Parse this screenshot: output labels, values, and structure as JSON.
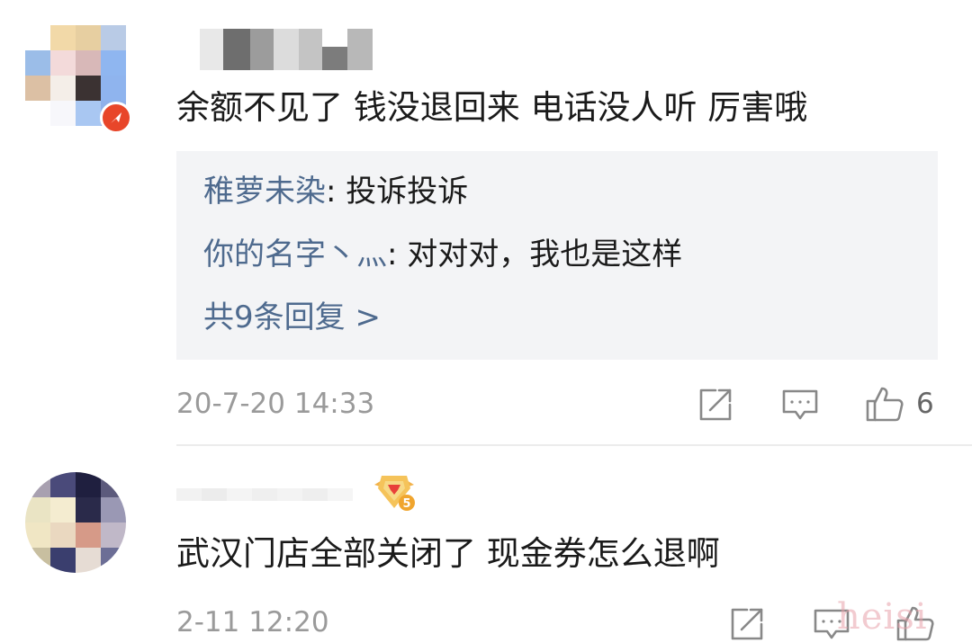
{
  "comments": [
    {
      "text": "余额不见了 钱没退回来 电话没人听 厉害哦",
      "replies": [
        {
          "author": "稚萝未染",
          "separator": ": ",
          "text": "投诉投诉"
        },
        {
          "author": "你的名字丶灬",
          "separator": ": ",
          "text": "对对对，我也是这样"
        }
      ],
      "more_replies": "共9条回复 >",
      "timestamp": "20-7-20 14:33",
      "likes": "6"
    },
    {
      "text": "武汉门店全部关闭了 现金券怎么退啊",
      "timestamp": "2-11 12:20",
      "level_badge": "5"
    }
  ],
  "watermark": "heisi",
  "icons": {
    "share": "share-icon",
    "comment": "comment-icon",
    "like": "thumbs-up-icon",
    "verified": "verified-badge-icon"
  },
  "colors": {
    "link": "#4e6a8e",
    "reply_background": "#f3f4f6",
    "timestamp": "#9a9a9a",
    "badge": "#e8462a"
  }
}
